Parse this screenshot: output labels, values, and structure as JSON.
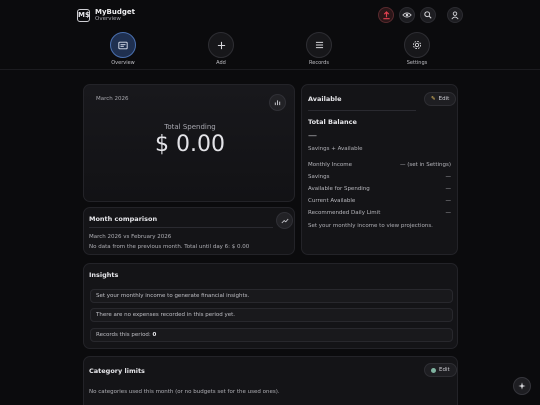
{
  "header": {
    "logo_text": "M$",
    "title": "MyBudget",
    "subtitle": "Overview"
  },
  "nav": [
    {
      "label": "Overview",
      "icon": "overview-icon",
      "active": true
    },
    {
      "label": "Add",
      "icon": "plus-icon",
      "active": false
    },
    {
      "label": "Records",
      "icon": "list-icon",
      "active": false
    },
    {
      "label": "Settings",
      "icon": "gear-icon",
      "active": false
    }
  ],
  "spending": {
    "month": "March 2026",
    "total_label": "Total Spending",
    "total_value": "$ 0.00"
  },
  "available": {
    "title": "Available",
    "edit_label": "Edit",
    "total_balance_label": "Total Balance",
    "total_balance_value": "—",
    "balance_hint": "Savings + Available",
    "rows": [
      {
        "label": "Monthly Income",
        "value": "— (set in Settings)"
      },
      {
        "label": "Savings",
        "value": "—"
      },
      {
        "label": "Available for Spending",
        "value": "—"
      },
      {
        "label": "Current Available",
        "value": "—"
      },
      {
        "label": "Recommended Daily Limit",
        "value": "—"
      }
    ],
    "note": "Set your monthly income to view projections."
  },
  "comparison": {
    "title": "Month comparison",
    "line1": "March 2026 vs February 2026",
    "line2": "No data from the previous month. Total until day 6: $ 0.00"
  },
  "insights": {
    "title": "Insights",
    "items": [
      "Set your monthly income to generate financial insights.",
      "There are no expenses recorded in this period yet."
    ],
    "records_label": "Records this period: ",
    "records_count": "0"
  },
  "limits": {
    "title": "Category limits",
    "edit_label": "Edit",
    "empty_text": "No categories used this month (or no budgets set for the used ones)."
  },
  "colors": {
    "accent": "#4a70b0",
    "export": "#e04050",
    "status_dot": "#7fb3a0"
  }
}
